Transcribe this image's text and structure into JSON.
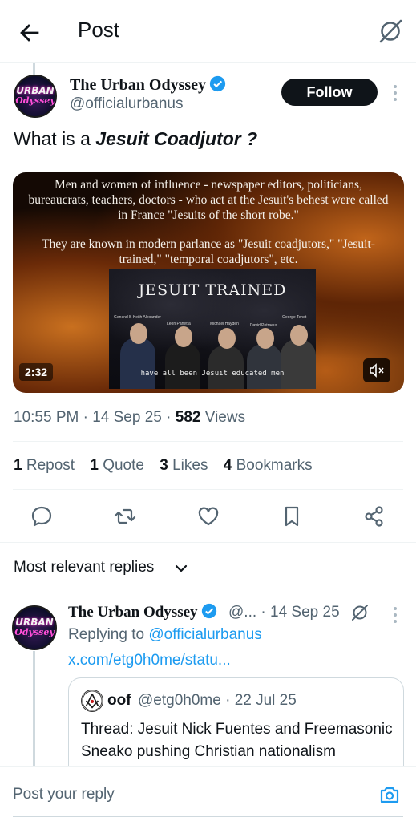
{
  "header": {
    "title": "Post"
  },
  "post": {
    "author_name": "The Urban Odyssey",
    "handle": "@officialurbanus",
    "avatar_text_top": "URBAN",
    "avatar_text_bottom": "Odyssey",
    "follow_label": "Follow",
    "text_prefix": "What is a ",
    "text_emphasis": "Jesuit Coadjutor ?",
    "media": {
      "caption_1": "Men and women of influence - newspaper editors, politicians, bureaucrats, teachers, doctors - who act at the Jesuit's behest were called in France \"Jesuits of the short robe.\"",
      "caption_2": "They are known in modern parlance as \"Jesuit coadjutors,\" \"Jesuit-trained,\" \"temporal coadjutors\", etc.",
      "panel_title": "Jesuit Trained",
      "panel_names": [
        "General B Keith Alexander",
        "Leon Panetta",
        "Michael Hayden",
        "David Petraeus",
        "George Tenet"
      ],
      "panel_subtitle": "have all been Jesuit educated men",
      "duration": "2:32"
    },
    "time": "10:55 PM",
    "date": "14 Sep 25",
    "views_count": "582",
    "views_label": "Views",
    "stats": [
      {
        "num": "1",
        "label": "Repost"
      },
      {
        "num": "1",
        "label": "Quote"
      },
      {
        "num": "3",
        "label": "Likes"
      },
      {
        "num": "4",
        "label": "Bookmarks"
      }
    ]
  },
  "replies": {
    "heading": "Most relevant replies",
    "items": [
      {
        "author_name": "The Urban Odyssey",
        "handle_trunc": "@...",
        "date": "14 Sep 25",
        "replying_label": "Replying to",
        "replying_handle": "@officialurbanus",
        "link_text": "x.com/etg0h0me/statu...",
        "quote": {
          "name": "oof",
          "handle": "@etg0h0me",
          "date": "22 Jul 25",
          "text": "Thread: Jesuit Nick Fuentes and Freemasonic Sneako pushing Christian nationalism"
        }
      }
    ]
  },
  "composer": {
    "placeholder": "Post your reply"
  },
  "colors": {
    "accent": "#1d9bf0",
    "text": "#0f1419",
    "muted": "#536471"
  }
}
